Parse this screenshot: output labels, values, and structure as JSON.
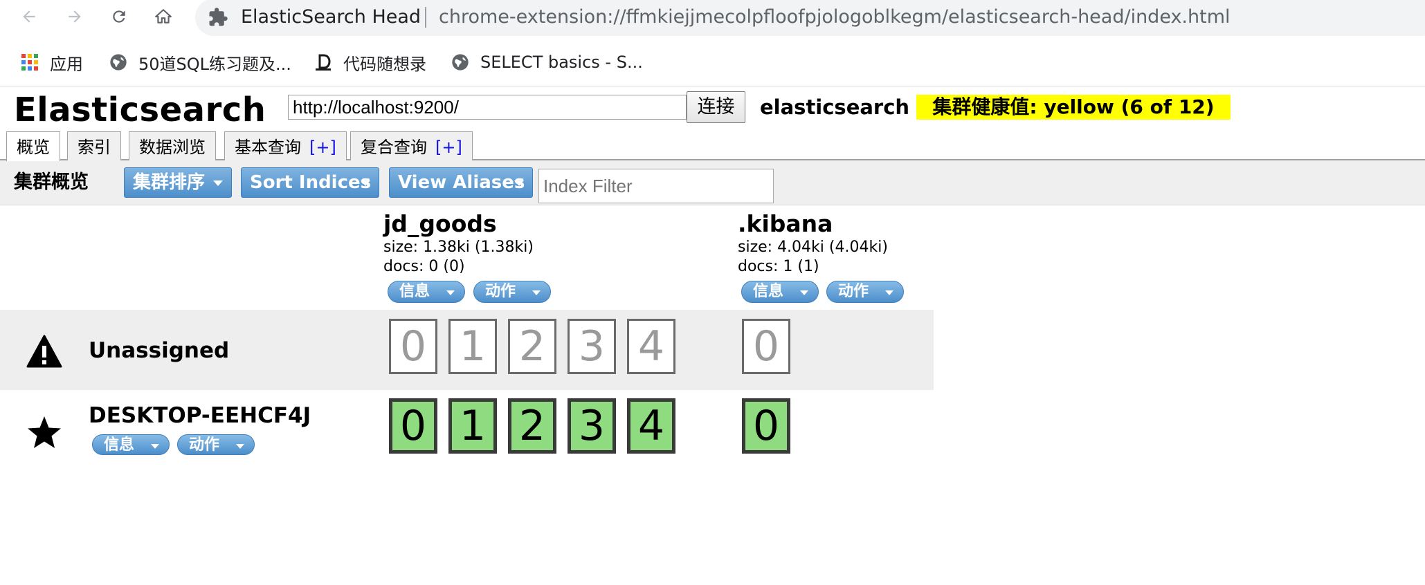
{
  "browser": {
    "site_title": "ElasticSearch Head",
    "url": "chrome-extension://ffmkiejjmecolpfloofpjologoblkegm/elasticsearch-head/index.html",
    "bookmarks": [
      {
        "label": "应用",
        "icon": "apps-grid-icon"
      },
      {
        "label": "50道SQL练习题及...",
        "icon": "globe-icon"
      },
      {
        "label": "代码随想录",
        "icon": "site-logo-icon"
      },
      {
        "label": "SELECT basics - S...",
        "icon": "globe-icon"
      }
    ]
  },
  "header": {
    "app_title": "Elasticsearch",
    "cluster_url": "http://localhost:9200/",
    "connect_label": "连接",
    "cluster_name": "elasticsearch",
    "health": "集群健康值: yellow (6 of 12)",
    "health_color": "#ffff00"
  },
  "tabs": [
    {
      "label": "概览",
      "active": true,
      "plus": ""
    },
    {
      "label": "索引",
      "active": false,
      "plus": ""
    },
    {
      "label": "数据浏览",
      "active": false,
      "plus": ""
    },
    {
      "label": "基本查询",
      "active": false,
      "plus": "[+]"
    },
    {
      "label": "复合查询",
      "active": false,
      "plus": "[+]"
    }
  ],
  "toolbar": {
    "title": "集群概览",
    "sort_cluster": "集群排序",
    "sort_indices": "Sort Indices",
    "view_aliases": "View Aliases",
    "filter_placeholder": "Index Filter"
  },
  "indices": [
    {
      "name": "jd_goods",
      "size": "size: 1.38ki (1.38ki)",
      "docs": "docs: 0 (0)",
      "info": "信息",
      "action": "动作",
      "shards": [
        "0",
        "1",
        "2",
        "3",
        "4"
      ]
    },
    {
      "name": ".kibana",
      "size": "size: 4.04ki (4.04ki)",
      "docs": "docs: 1 (1)",
      "info": "信息",
      "action": "动作",
      "shards": [
        "0"
      ]
    }
  ],
  "nodes": [
    {
      "name": "Unassigned",
      "icon": "warning-icon"
    },
    {
      "name": "DESKTOP-EEHCF4J",
      "icon": "star-icon",
      "info": "信息",
      "action": "动作"
    }
  ],
  "colors": {
    "button_blue": "#4d8fcb",
    "shard_started": "#8fdc80",
    "shard_unassigned_text": "#9a9a9a"
  }
}
